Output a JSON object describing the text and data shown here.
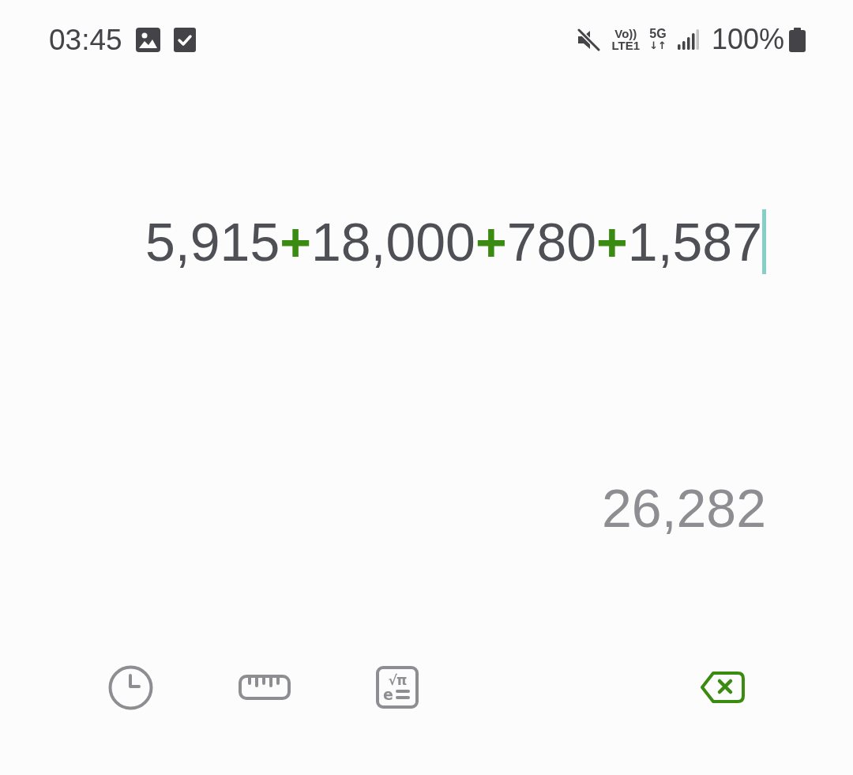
{
  "status_bar": {
    "time": "03:45",
    "volte": [
      "Vo))",
      "LTE1"
    ],
    "network": [
      "5G",
      "↓↑"
    ],
    "battery": "100%"
  },
  "expression": {
    "focused": true,
    "tokens": [
      {
        "kind": "number",
        "text": "5,915"
      },
      {
        "kind": "operator",
        "text": "+"
      },
      {
        "kind": "number",
        "text": "18,000"
      },
      {
        "kind": "operator",
        "text": "+"
      },
      {
        "kind": "number",
        "text": "780"
      },
      {
        "kind": "operator",
        "text": "+"
      },
      {
        "kind": "number",
        "text": "1,587"
      }
    ]
  },
  "result": "26,282",
  "toolbar": {
    "scientific_labels": [
      "√π",
      "e"
    ],
    "backspace_enabled": true
  }
}
